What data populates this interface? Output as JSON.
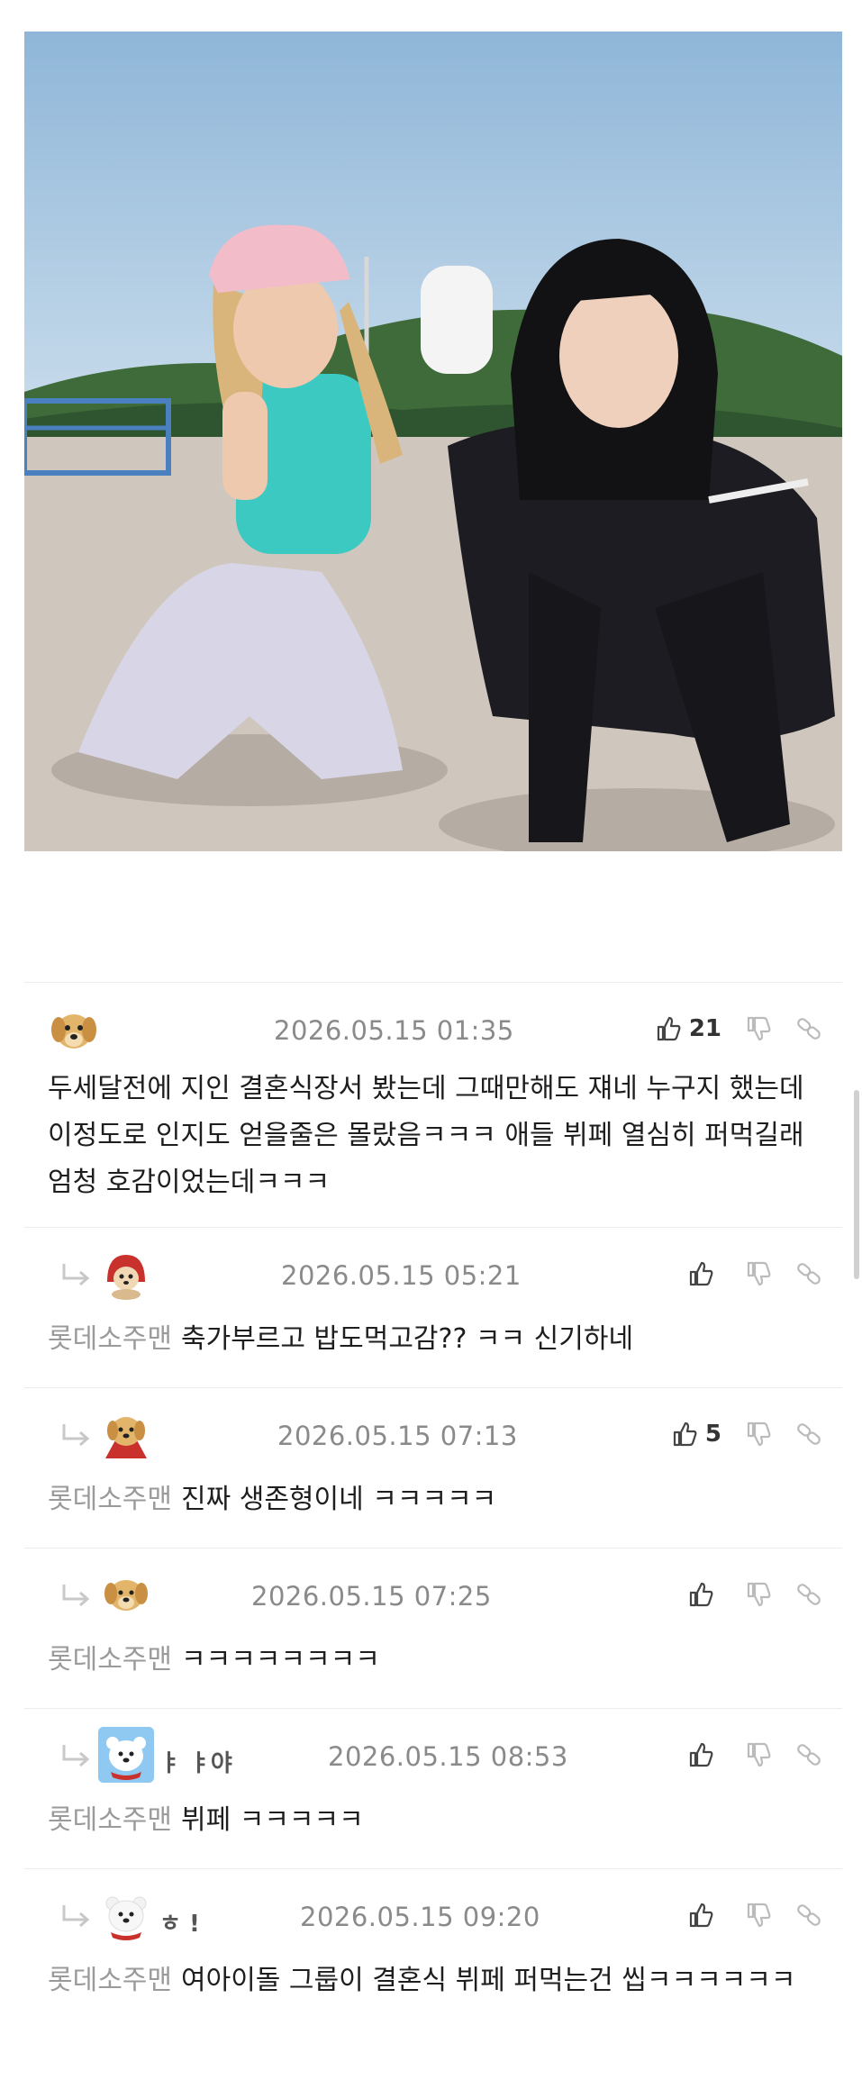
{
  "photo": {
    "icon": "photo-two-women-seaside",
    "colors": {
      "sky": "#a8c6e0",
      "ground": "#cfc7bd",
      "hill": "#3f6a3a"
    }
  },
  "comments": [
    {
      "type": "top",
      "avatar_icon": "puppy-avatar-icon",
      "date": "2026.05.15 01:35",
      "likes": "21",
      "text": "두세달전에 지인 결혼식장서 봤는데 그때만해도 쟤네 누구지 했는데 이정도로 인지도 얻을줄은 몰랐음ㅋㅋㅋ 애들 뷔페 열심히 퍼먹길래 엄청 호감이었는데ㅋㅋㅋ"
    },
    {
      "type": "reply",
      "avatar_icon": "red-hood-dog-avatar-icon",
      "date": "2026.05.15 05:21",
      "likes": "",
      "mention": "롯데소주맨",
      "text": "축가부르고 밥도먹고감?? ㅋㅋ 신기하네"
    },
    {
      "type": "reply",
      "avatar_icon": "puppy-cape-avatar-icon",
      "date": "2026.05.15 07:13",
      "likes": "5",
      "mention": "롯데소주맨",
      "text": "진짜 생존형이네 ㅋㅋㅋㅋㅋ"
    },
    {
      "type": "reply",
      "avatar_icon": "puppy-avatar-icon",
      "date": "2026.05.15 07:25",
      "likes": "",
      "mention": "롯데소주맨",
      "text": "ㅋㅋㅋㅋㅋㅋㅋㅋ"
    },
    {
      "type": "reply",
      "avatar_icon": "polar-bear-avatar-icon",
      "name_fragment": "ㅑ   ㅑ야",
      "date": "2026.05.15 08:53",
      "likes": "",
      "mention": "롯데소주맨",
      "text": "뷔페 ㅋㅋㅋㅋㅋ"
    },
    {
      "type": "reply",
      "avatar_icon": "polar-bear-avatar-icon",
      "name_fragment": "ㅎ   !",
      "date": "2026.05.15 09:20",
      "likes": "",
      "mention": "롯데소주맨",
      "text": "여아이돌 그룹이 결혼식 뷔페 퍼먹는건 씹ㅋㅋㅋㅋㅋㅋ"
    }
  ],
  "icons": {
    "like": "thumbs-up-icon",
    "dislike": "thumbs-down-icon",
    "link": "link-icon",
    "reply": "reply-arrow-icon"
  }
}
